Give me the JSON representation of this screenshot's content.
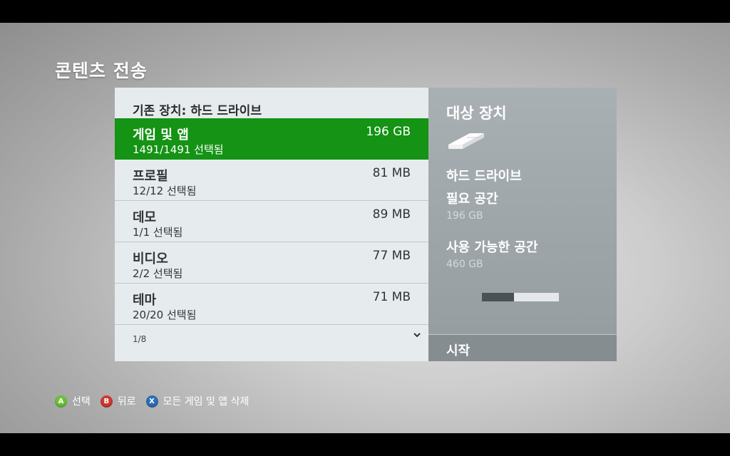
{
  "page_title": "콘텐츠 전송",
  "source": {
    "header": "기존 장치: 하드 드라이브",
    "items": [
      {
        "name": "게임 및 앱",
        "sub": "1491/1491 선택됨",
        "size": "196 GB"
      },
      {
        "name": "프로필",
        "sub": "12/12 선택됨",
        "size": "81 MB"
      },
      {
        "name": "데모",
        "sub": "1/1 선택됨",
        "size": "89 MB"
      },
      {
        "name": "비디오",
        "sub": "2/2 선택됨",
        "size": "77 MB"
      },
      {
        "name": "테마",
        "sub": "20/20 선택됨",
        "size": "71 MB"
      }
    ],
    "selected_index": 0,
    "page_indicator": "1/8"
  },
  "target": {
    "title": "대상 장치",
    "device_icon": "hard-drive-icon",
    "device_name": "하드 드라이브",
    "required_label": "필요 공간",
    "required_value": "196 GB",
    "available_label": "사용 가능한 공간",
    "available_value": "460 GB",
    "usage_fraction": 0.42,
    "start_label": "시작"
  },
  "footer": {
    "hints": [
      {
        "button": "A",
        "label": "선택",
        "color": "#6cc33a"
      },
      {
        "button": "B",
        "label": "뒤로",
        "color": "#cf3b33"
      },
      {
        "button": "X",
        "label": "모든 게임 및 앱 삭제",
        "color": "#2f6fb6"
      }
    ]
  },
  "colors": {
    "accent_green": "#149314"
  }
}
